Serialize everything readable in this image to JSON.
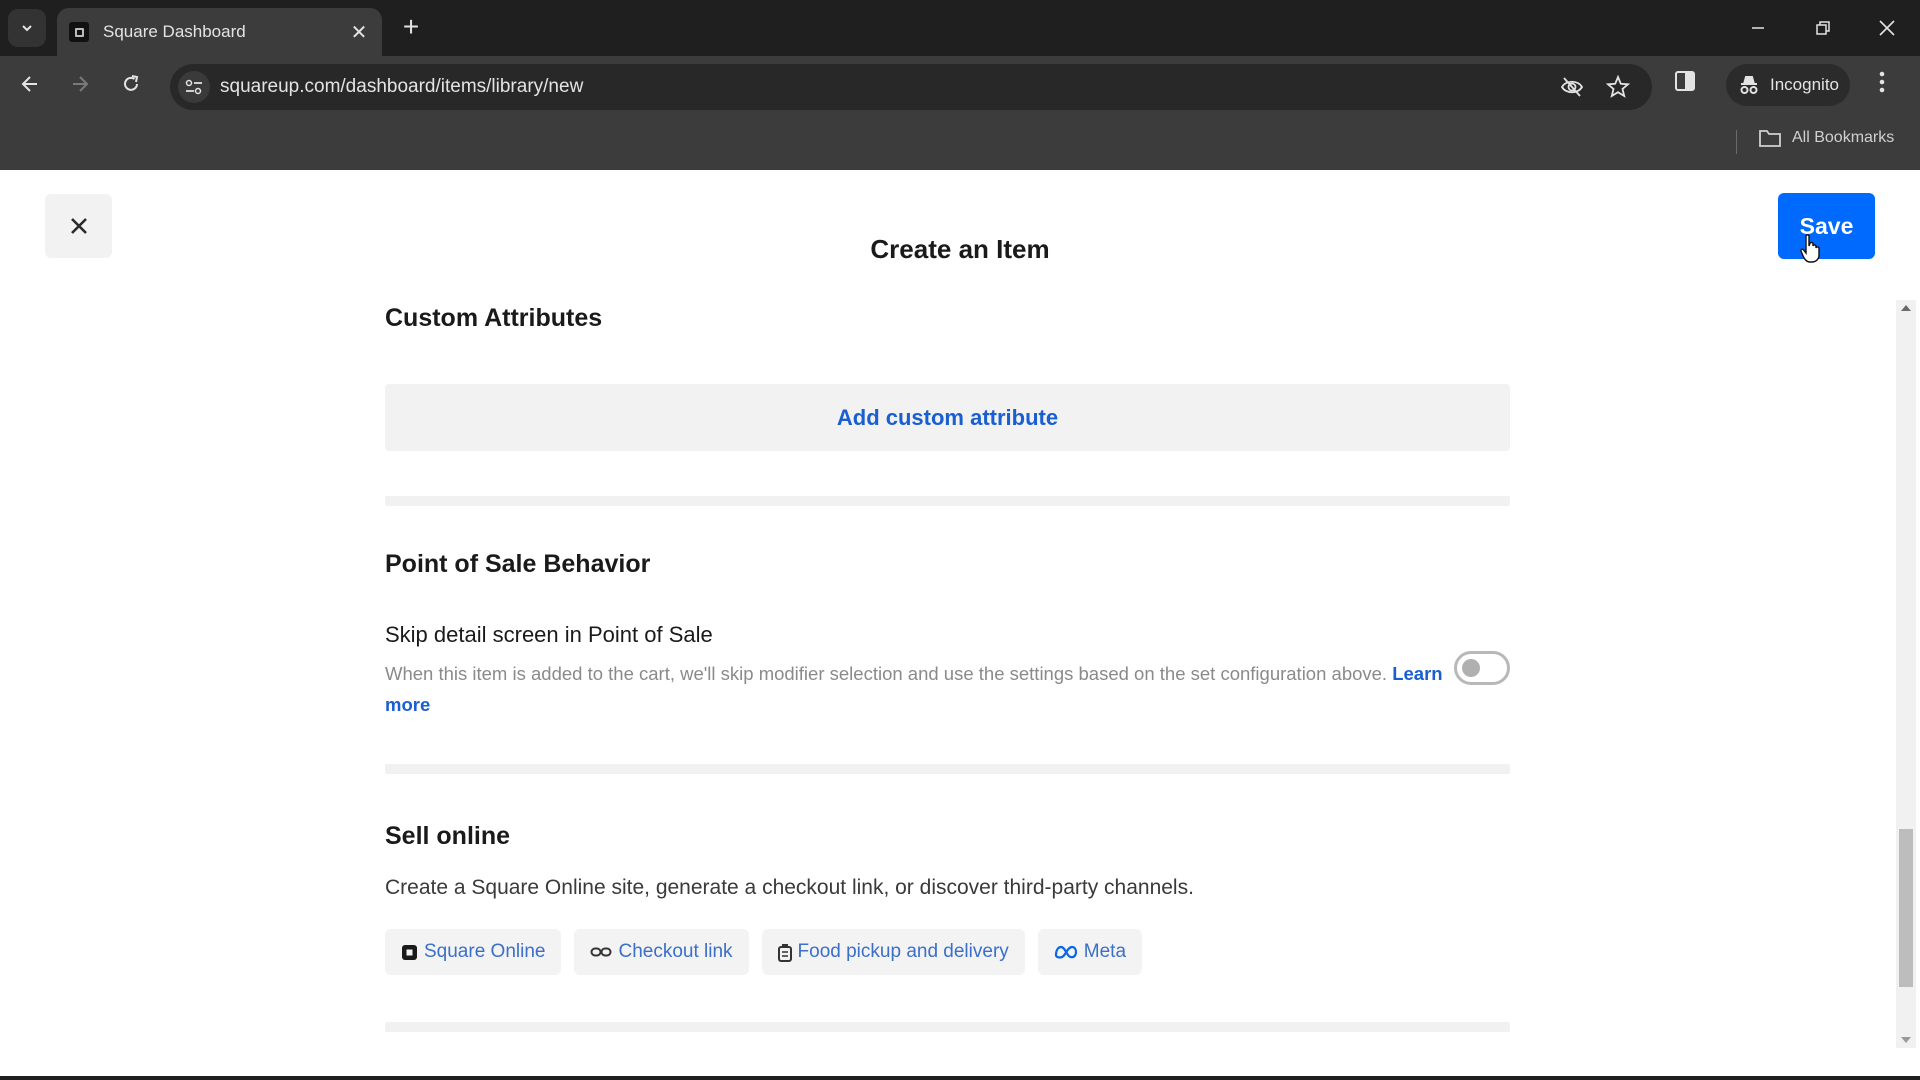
{
  "browser": {
    "tab": {
      "title": "Square Dashboard",
      "favicon": "square-logo-icon"
    },
    "url": "squareup.com/dashboard/items/library/new",
    "profile_label": "Incognito",
    "bookmarks_label": "All Bookmarks",
    "icons": {
      "tab_search": "chevron-down-icon",
      "new_tab": "plus-icon",
      "back": "arrow-left-icon",
      "forward": "arrow-right-icon",
      "reload": "reload-icon",
      "site_info": "tune-icon",
      "tracking": "eye-off-icon",
      "bookmark": "star-icon",
      "side_panel": "side-panel-icon",
      "incognito": "incognito-icon",
      "menu": "more-vert-icon",
      "folder": "folder-icon"
    }
  },
  "page": {
    "title": "Create an Item",
    "save_label": "Save",
    "close_icon": "close-icon",
    "accent_color": "#006aff",
    "link_color": "#1a5fd0"
  },
  "custom_attributes": {
    "heading": "Custom Attributes",
    "add_label": "Add custom attribute"
  },
  "pos_behavior": {
    "heading": "Point of Sale Behavior",
    "skip_label": "Skip detail screen in Point of Sale",
    "skip_desc": "When this item is added to the cart, we'll skip modifier selection and use the settings based on the set configuration above.",
    "learn_more": "Learn more",
    "skip_enabled": false
  },
  "sell_online": {
    "heading": "Sell online",
    "description": "Create a Square Online site, generate a checkout link, or discover third-party channels.",
    "channels": [
      {
        "label": "Square Online",
        "icon": "square-logo-icon"
      },
      {
        "label": "Checkout link",
        "icon": "link-icon"
      },
      {
        "label": "Food pickup and delivery",
        "icon": "food-bag-icon"
      },
      {
        "label": "Meta",
        "icon": "meta-logo-icon"
      }
    ]
  },
  "scroll": {
    "position_fraction": 0.92,
    "visible_fraction": 0.22
  }
}
